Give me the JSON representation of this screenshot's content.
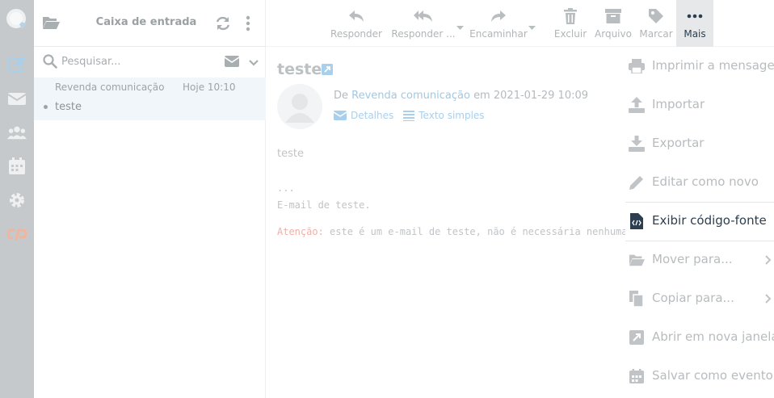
{
  "folder": {
    "title": "Caixa de entrada"
  },
  "search": {
    "placeholder": "Pesquisar..."
  },
  "messages": [
    {
      "from": "Revenda comunicação",
      "date": "Hoje 10:10",
      "subject": "teste"
    }
  ],
  "toolbar": {
    "reply": "Responder",
    "reply_all": "Responder ...",
    "forward": "Encaminhar",
    "delete": "Excluir",
    "archive": "Arquivo",
    "mark": "Marcar",
    "more": "Mais"
  },
  "mail": {
    "subject": "teste",
    "from_prefix": "De",
    "from_name": "Revenda comunicação",
    "date_prefix": "em",
    "date": "2021-01-29 10:09",
    "details": "Detalhes",
    "plain_text": "Texto simples",
    "body_line1": "teste",
    "body_dots": "...",
    "body_line2": "E-mail de teste.",
    "warning_label": "Atenção:",
    "warning_text": "este é um e-mail de teste, não é necessária nenhuma"
  },
  "menu": {
    "print": "Imprimir a mensagem",
    "import": "Importar",
    "export": "Exportar",
    "edit_as_new": "Editar como novo",
    "view_source": "Exibir código-fonte",
    "move_to": "Mover para...",
    "copy_to": "Copiar para...",
    "open_new_window": "Abrir em nova janela",
    "save_as_event": "Salvar como evento"
  },
  "colors": {
    "rail": "#c5c9cb",
    "link": "#9ec9e6",
    "selected_row": "#f0f6fa",
    "menu_active_text": "#2c3e50"
  }
}
